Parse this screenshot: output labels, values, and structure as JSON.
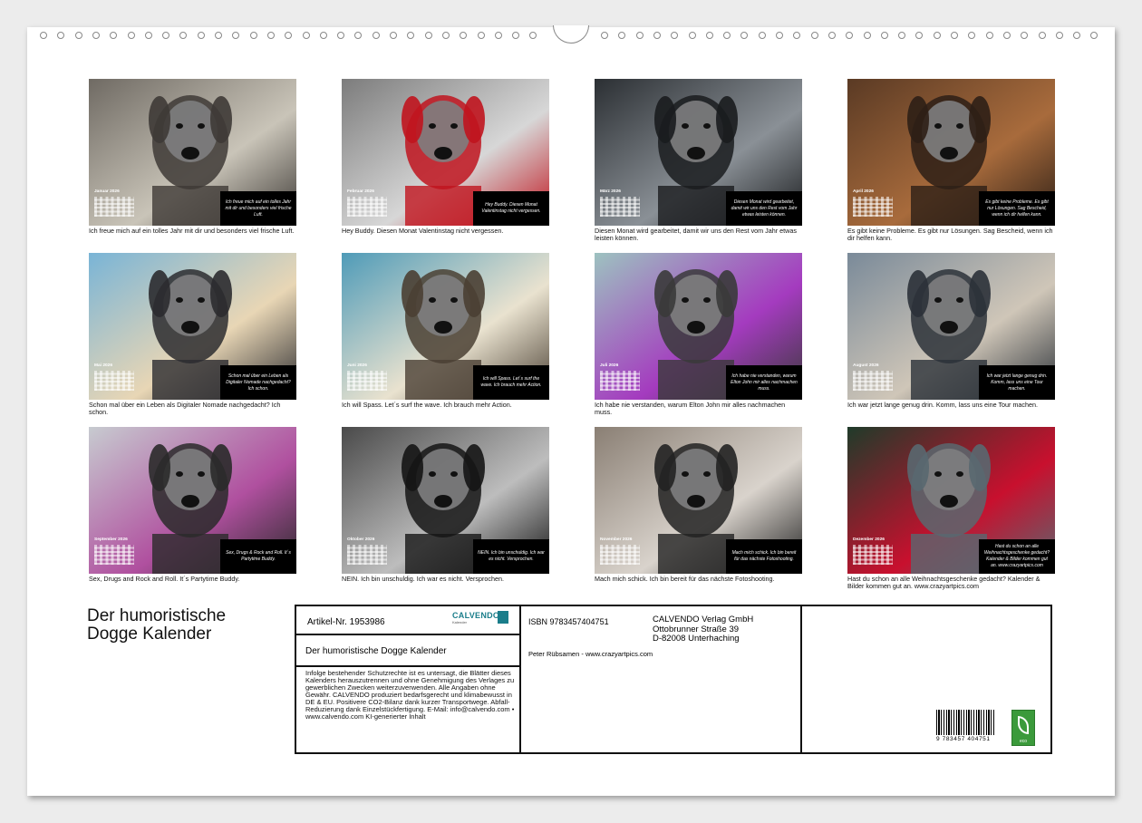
{
  "calendar": {
    "title_line1": "Der humoristische",
    "title_line2": "Dogge Kalender",
    "months": [
      {
        "id": "jan",
        "label": "Januar 2026",
        "quote": "Ich freue mich auf ein tolles Jahr mit dir und besonders viel frische Luft.",
        "caption": "Ich freue mich auf ein tolles Jahr mit dir und besonders viel frische Luft.",
        "colors": [
          "#6f6a63",
          "#c9c4b8",
          "#3e3a36"
        ]
      },
      {
        "id": "feb",
        "label": "Februar 2026",
        "quote": "Hey Buddy. Diesen Monat Valentinstag nicht vergessen.",
        "caption": "Hey Buddy. Diesen Monat Valentinstag nicht vergessen.",
        "colors": [
          "#7c7c7c",
          "#d7d7d7",
          "#c0141e"
        ]
      },
      {
        "id": "mar",
        "label": "März 2026",
        "quote": "Diesen Monat wird gearbeitet, damit wir uns den Rest vom Jahr etwas leisten können.",
        "caption": "Diesen Monat wird gearbeitet, damit wir uns den Rest vom Jahr etwas leisten können.",
        "colors": [
          "#2b2f33",
          "#8a9096",
          "#1a1c1e"
        ]
      },
      {
        "id": "apr",
        "label": "April 2026",
        "quote": "Es gibt keine Probleme. Es gibt nur Lösungen. Sag Bescheid, wenn ich dir helfen kann.",
        "caption": "Es gibt keine Probleme. Es gibt nur Lösungen. Sag Bescheid, wenn ich dir helfen kann.",
        "colors": [
          "#5a3a24",
          "#a86b3c",
          "#2d1f16"
        ]
      },
      {
        "id": "mai",
        "label": "Mai 2026",
        "quote": "Schon mal über ein Leben als Digitaler Nomade nachgedacht? Ich schon.",
        "caption": "Schon mal über ein Leben als Digitaler Nomade nachgedacht? Ich schon.",
        "colors": [
          "#79b4d6",
          "#e8d6b5",
          "#2b2b2f"
        ]
      },
      {
        "id": "jun",
        "label": "Juni 2026",
        "quote": "Ich will Spass. Let´s surf the wave. Ich brauch mehr Action.",
        "caption": "Ich will Spass. Let´s surf the wave. Ich brauch mehr Action.",
        "colors": [
          "#4f9bb8",
          "#e9e2cf",
          "#4a3f33"
        ]
      },
      {
        "id": "jul",
        "label": "Juli 2026",
        "quote": "Ich habe nie verstanden, warum Elton John mir alles nachmachen muss.",
        "caption": "Ich habe nie verstanden, warum Elton John mir alles nachmachen muss.",
        "colors": [
          "#9dc2c0",
          "#a43bbf",
          "#3a3a3a"
        ]
      },
      {
        "id": "aug",
        "label": "August 2026",
        "quote": "Ich war jetzt lange genug drin. Komm, lass uns eine Tour machen.",
        "caption": "Ich war jetzt lange genug drin. Komm, lass uns eine Tour machen.",
        "colors": [
          "#7a8a99",
          "#cfc6b8",
          "#2b3138"
        ]
      },
      {
        "id": "sep",
        "label": "September 2026",
        "quote": "Sex, Drugs & Rock and Roll. It´s Partytime Buddy.",
        "caption": "Sex, Drugs and Rock and Roll. It´s Partytime Buddy.",
        "colors": [
          "#c7cbd0",
          "#b0509f",
          "#2a2a2a"
        ]
      },
      {
        "id": "okt",
        "label": "Oktober 2026",
        "quote": "NEIN. Ich bin unschuldig. Ich war es nicht. Versprochen.",
        "caption": "NEIN. Ich bin unschuldig. Ich war es nicht. Versprochen.",
        "colors": [
          "#4a4a4a",
          "#bdbdbd",
          "#151515"
        ]
      },
      {
        "id": "nov",
        "label": "November 2026",
        "quote": "Mach mich schick. Ich bin bereit für das nächste Fotoshooting.",
        "caption": "Mach mich schick. Ich bin bereit für das nächste Fotoshooting.",
        "colors": [
          "#8a7f74",
          "#d9d3cc",
          "#222222"
        ]
      },
      {
        "id": "dez",
        "label": "Dezember 2026",
        "quote": "Hast du schon an alle Weihnachtsgeschenke gedacht? Kalender & Bilder kommen gut an. www.crazyartpics.com",
        "caption": "Hast du schon an alle Weihnachtsgeschenke gedacht? Kalender & Bilder kommen gut an. www.crazyartpics.com",
        "colors": [
          "#1f3b2a",
          "#c8102e",
          "#596870"
        ]
      }
    ]
  },
  "imprint": {
    "article": "Artikel-Nr. 1953986",
    "brand": "CALVENDO",
    "brand_sub": "Kalender",
    "product_title": "Der humoristische Dogge Kalender",
    "legal": "Infolge bestehender Schutzrechte ist es untersagt, die Blätter dieses Kalenders herauszutrennen und ohne Genehmigung des Verlages zu gewerblichen Zwecken weiterzuverwenden. Alle Angaben ohne Gewähr. CALVENDO produziert bedarfsgerecht und klimabewusst in DE & EU. Positivere CO2-Bilanz dank kurzer Transportwege. Abfall-Reduzierung dank Einzelstückfertigung. E-Mail: info@calvendo.com • www.calvendo.com KI-generierter Inhalt",
    "isbn": "ISBN 9783457404751",
    "publisher_line1": "CALVENDO Verlag GmbH",
    "publisher_line2": "Ottobrunner Straße 39",
    "publisher_line3": "D-82008 Unterhaching",
    "author": "Peter Rübsamen - www.crazyartpics.com",
    "barcode_text": "9 783457 404751",
    "eco_label": "eco"
  }
}
